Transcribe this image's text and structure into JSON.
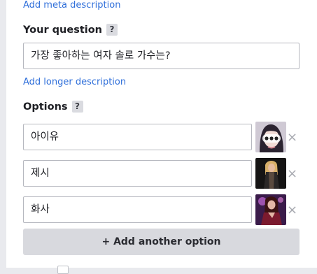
{
  "meta_link": "Add meta description",
  "question": {
    "label": "Your question",
    "help": "?",
    "value": "가장 좋아하는 여자 솔로 가수는?"
  },
  "longer_link": "Add longer description",
  "options": {
    "label": "Options",
    "help": "?",
    "items": [
      {
        "value": "아이유",
        "remove": "×"
      },
      {
        "value": "제시",
        "remove": "×"
      },
      {
        "value": "화사",
        "remove": "×"
      }
    ]
  },
  "add_button": "+ Add another option"
}
